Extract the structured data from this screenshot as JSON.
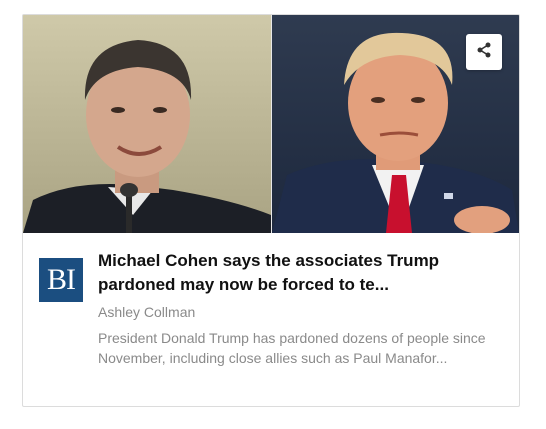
{
  "article": {
    "headline": "Michael Cohen says the associates Trump pardoned may now be forced to te...",
    "author": "Ashley Collman",
    "summary": "President Donald Trump has pardoned dozens of people since November, including close allies such as Paul Manafor...",
    "publisher_logo_text": "BI"
  },
  "images": {
    "left": "photo-michael-cohen",
    "right": "photo-donald-trump"
  },
  "icons": {
    "share": "share-icon"
  },
  "colors": {
    "publisher_brand": "#1b4e80",
    "headline": "#111111",
    "meta_text": "#8a8a8a",
    "card_border": "#dcdcdc"
  }
}
